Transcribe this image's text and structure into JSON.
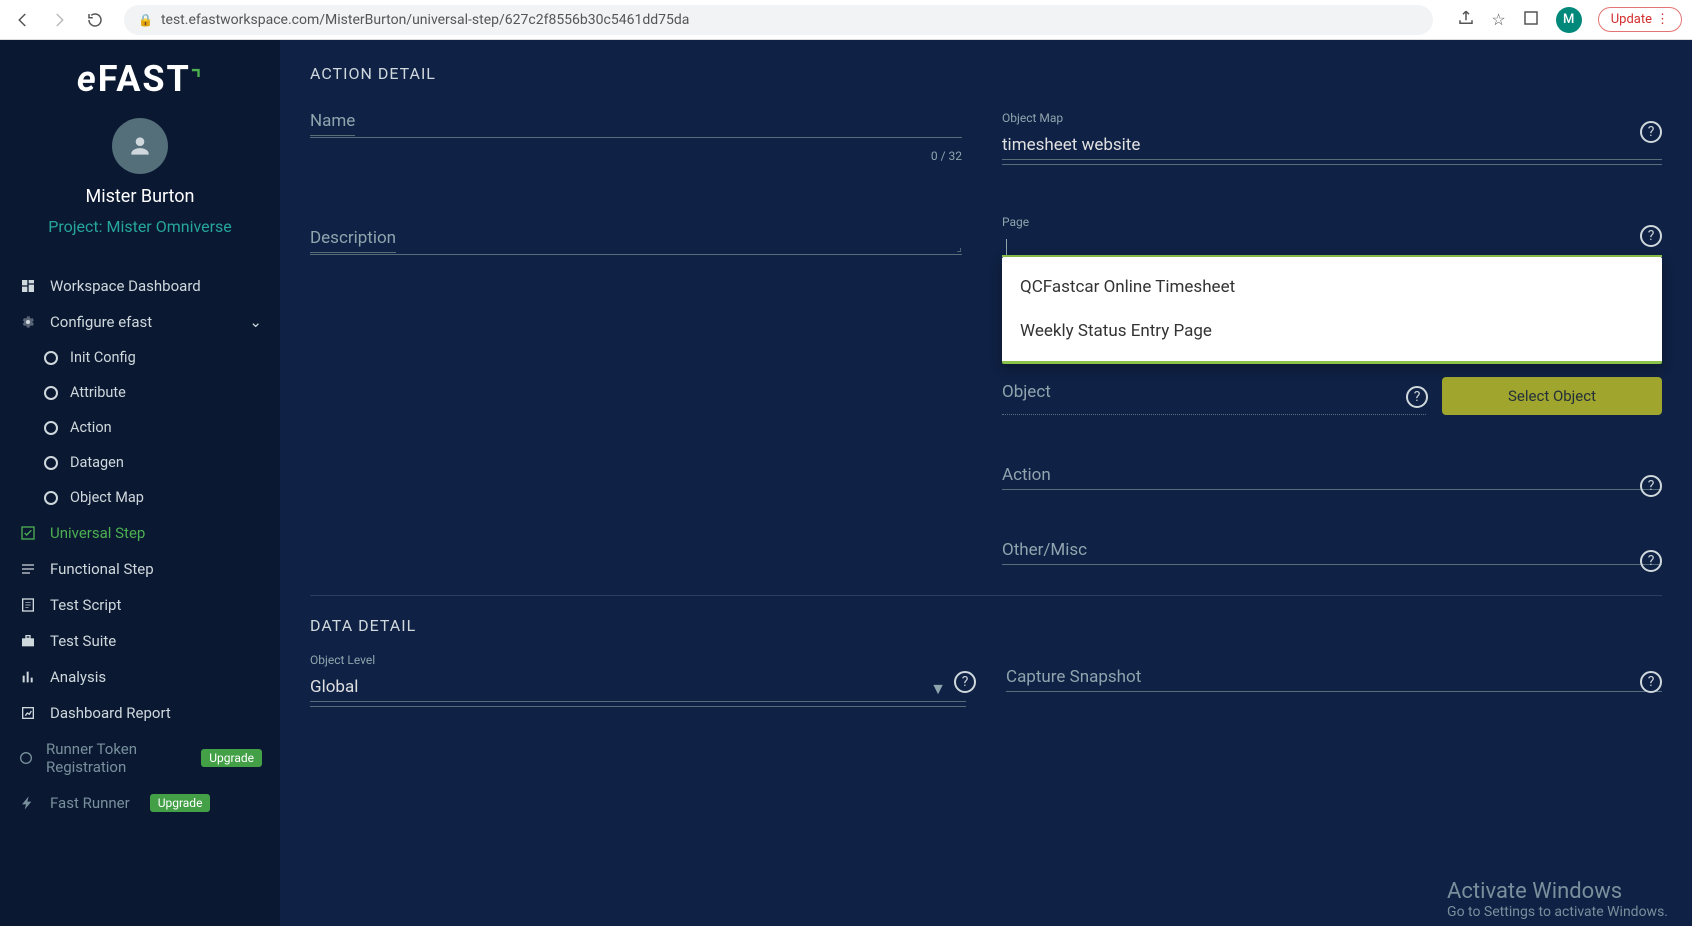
{
  "browser": {
    "url": "test.efastworkspace.com/MisterBurton/universal-step/627c2f8556b30c5461dd75da",
    "avatar_letter": "M",
    "update_label": "Update"
  },
  "logo": {
    "text_a": "e",
    "text_b": "FAST"
  },
  "user": {
    "name": "Mister Burton",
    "project": "Project: Mister Omniverse"
  },
  "sidebar": {
    "items": [
      {
        "label": "Workspace Dashboard"
      },
      {
        "label": "Configure efast"
      },
      {
        "label": "Init Config"
      },
      {
        "label": "Attribute"
      },
      {
        "label": "Action"
      },
      {
        "label": "Datagen"
      },
      {
        "label": "Object Map"
      },
      {
        "label": "Universal Step"
      },
      {
        "label": "Functional Step"
      },
      {
        "label": "Test Script"
      },
      {
        "label": "Test Suite"
      },
      {
        "label": "Analysis"
      },
      {
        "label": "Dashboard Report"
      },
      {
        "label": "Runner Token Registration"
      },
      {
        "label": "Fast Runner"
      }
    ],
    "upgrade": "Upgrade"
  },
  "form": {
    "section1": "ACTION DETAIL",
    "name_label": "Name",
    "name_counter": "0 / 32",
    "description_label": "Description",
    "object_map_label": "Object Map",
    "object_map_value": "timesheet website",
    "page_label": "Page",
    "page_options": [
      "QCFastcar Online Timesheet",
      "Weekly Status Entry Page"
    ],
    "object_label": "Object",
    "select_object_btn": "Select Object",
    "action_label": "Action",
    "other_label": "Other/Misc",
    "section2": "DATA DETAIL",
    "object_level_label": "Object Level",
    "object_level_value": "Global",
    "capture_label": "Capture Snapshot"
  },
  "watermark": {
    "line1": "Activate Windows",
    "line2": "Go to Settings to activate Windows."
  }
}
